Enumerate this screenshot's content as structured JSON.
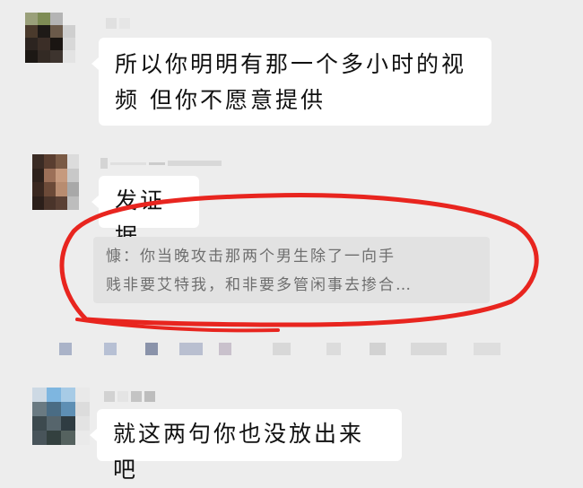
{
  "messages": [
    {
      "id": "msg1",
      "text_line1": "所以你明明有那一个多小时的视",
      "text_line2": "频 但你不愿意提供"
    },
    {
      "id": "msg2",
      "text": "发证据",
      "quote": {
        "sender": "慷",
        "separator": "：",
        "text_line1": "你当晚攻击那两个男生除了一向手",
        "text_line2": "贱非要艾特我，和非要多管闲事去掺合…"
      }
    },
    {
      "id": "msg3",
      "text": "就这两句你也没放出来吧"
    }
  ],
  "colors": {
    "background": "#ededed",
    "bubble": "#ffffff",
    "quote_bg": "#e2e2e2",
    "annotation": "#e8251f"
  },
  "icons": {
    "avatar1": "pixelated-avatar",
    "avatar2": "pixelated-avatar",
    "avatar3": "pixelated-avatar"
  }
}
